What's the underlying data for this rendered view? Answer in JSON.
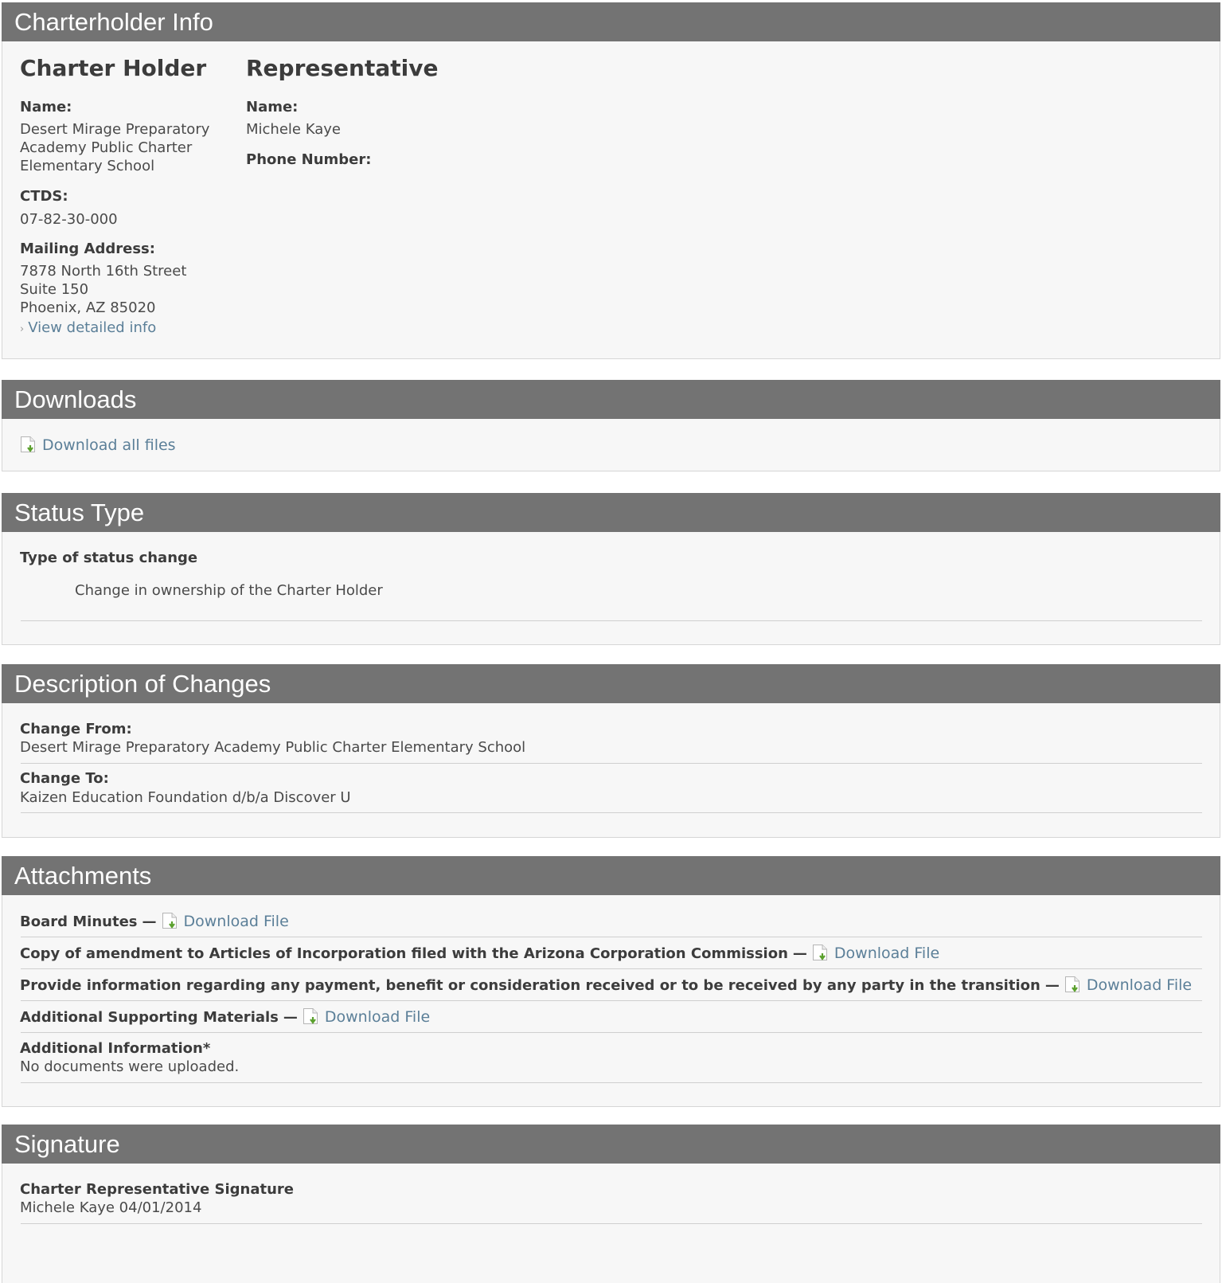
{
  "charterholder": {
    "header": "Charterholder Info",
    "holder": {
      "title": "Charter Holder",
      "name_label": "Name:",
      "name_lines": [
        "Desert Mirage Preparatory",
        "Academy Public Charter",
        "Elementary School"
      ],
      "ctds_label": "CTDS:",
      "ctds": "07-82-30-000",
      "mailing_label": "Mailing Address:",
      "address_lines": [
        "7878 North 16th Street",
        "Suite 150",
        "Phoenix, AZ 85020"
      ],
      "detail_link": "View detailed info"
    },
    "representative": {
      "title": "Representative",
      "name_label": "Name:",
      "name": "Michele Kaye",
      "phone_label": "Phone Number:"
    }
  },
  "downloads": {
    "header": "Downloads",
    "all_files_link": "Download all files"
  },
  "status_type": {
    "header": "Status Type",
    "label": "Type of status change",
    "value": "Change in ownership of the Charter Holder"
  },
  "description": {
    "header": "Description of Changes",
    "from_label": "Change From:",
    "from_value": "Desert Mirage Preparatory Academy Public Charter Elementary School",
    "to_label": "Change To:",
    "to_value": "Kaizen Education Foundation d/b/a Discover U"
  },
  "attachments": {
    "header": "Attachments",
    "dash": "—",
    "link_label": "Download File",
    "items": [
      {
        "label": "Board Minutes"
      },
      {
        "label": "Copy of amendment to Articles of Incorporation filed with the Arizona Corporation Commission"
      },
      {
        "label": "Provide information regarding any payment, benefit or consideration received or to be received by any party in the transition"
      },
      {
        "label": "Additional Supporting Materials"
      }
    ],
    "additional_label": "Additional Information*",
    "additional_value": "No documents were uploaded."
  },
  "signature": {
    "header": "Signature",
    "label": "Charter Representative Signature",
    "value": "Michele Kaye 04/01/2014"
  },
  "colors": {
    "header_bg": "#737373",
    "panel_bg": "#f7f7f7",
    "link": "#5b7f98",
    "icon_green": "#5aa02c"
  }
}
